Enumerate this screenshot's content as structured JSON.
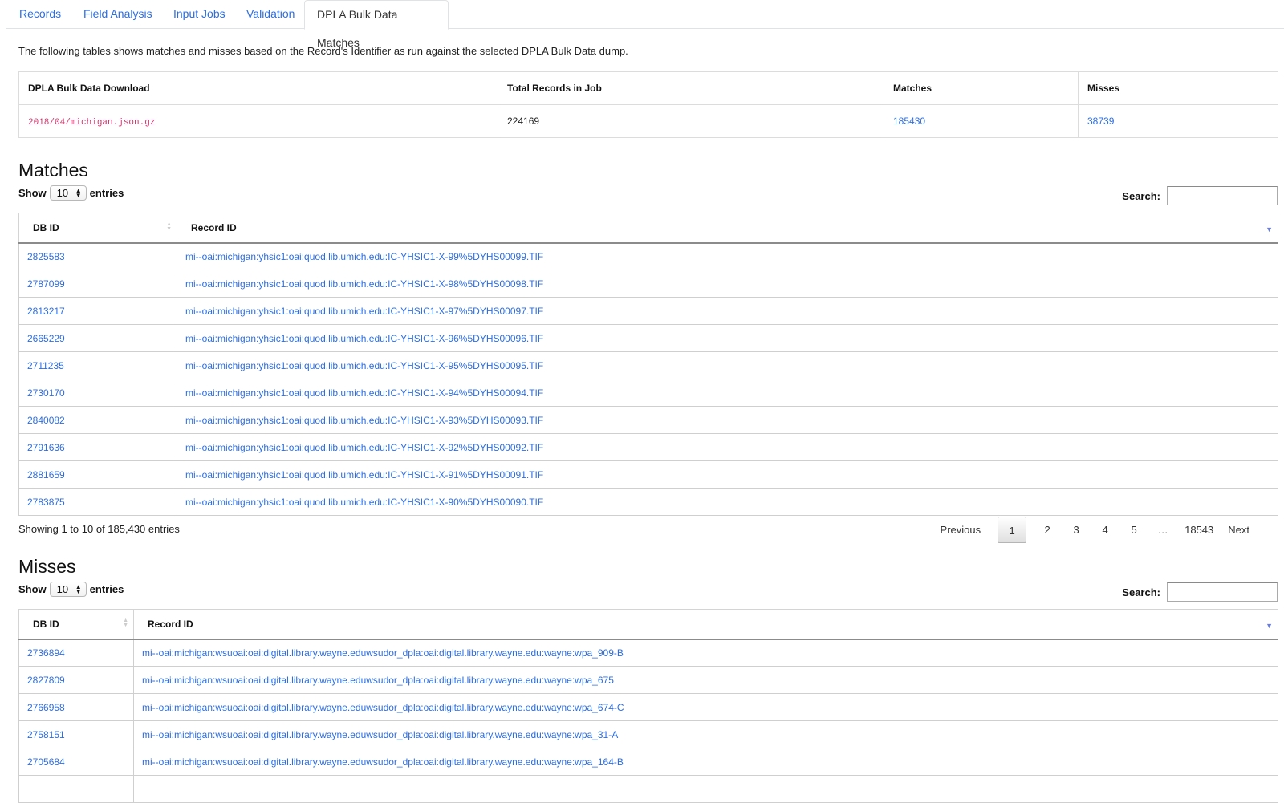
{
  "tabs": [
    {
      "label": "Records",
      "active": false
    },
    {
      "label": "Field Analysis",
      "active": false
    },
    {
      "label": "Input Jobs",
      "active": false
    },
    {
      "label": "Validation",
      "active": false
    },
    {
      "label": "DPLA Bulk Data Matches",
      "active": true
    }
  ],
  "intro": "The following tables shows matches and misses based on the Record's Identifier as run against the selected DPLA Bulk Data dump.",
  "summary": {
    "headers": [
      "DPLA Bulk Data Download",
      "Total Records in Job",
      "Matches",
      "Misses"
    ],
    "row": {
      "download": "2018/04/michigan.json.gz",
      "total": "224169",
      "matches": "185430",
      "misses": "38739"
    }
  },
  "matches": {
    "title": "Matches",
    "show_label": "Show",
    "entries_label": "entries",
    "page_length": "10",
    "search_label": "Search:",
    "search_value": "",
    "columns": [
      "DB ID",
      "Record ID"
    ],
    "rows": [
      {
        "db_id": "2825583",
        "record_id": "mi--oai:michigan:yhsic1:oai:quod.lib.umich.edu:IC-YHSIC1-X-99%5DYHS00099.TIF"
      },
      {
        "db_id": "2787099",
        "record_id": "mi--oai:michigan:yhsic1:oai:quod.lib.umich.edu:IC-YHSIC1-X-98%5DYHS00098.TIF"
      },
      {
        "db_id": "2813217",
        "record_id": "mi--oai:michigan:yhsic1:oai:quod.lib.umich.edu:IC-YHSIC1-X-97%5DYHS00097.TIF"
      },
      {
        "db_id": "2665229",
        "record_id": "mi--oai:michigan:yhsic1:oai:quod.lib.umich.edu:IC-YHSIC1-X-96%5DYHS00096.TIF"
      },
      {
        "db_id": "2711235",
        "record_id": "mi--oai:michigan:yhsic1:oai:quod.lib.umich.edu:IC-YHSIC1-X-95%5DYHS00095.TIF"
      },
      {
        "db_id": "2730170",
        "record_id": "mi--oai:michigan:yhsic1:oai:quod.lib.umich.edu:IC-YHSIC1-X-94%5DYHS00094.TIF"
      },
      {
        "db_id": "2840082",
        "record_id": "mi--oai:michigan:yhsic1:oai:quod.lib.umich.edu:IC-YHSIC1-X-93%5DYHS00093.TIF"
      },
      {
        "db_id": "2791636",
        "record_id": "mi--oai:michigan:yhsic1:oai:quod.lib.umich.edu:IC-YHSIC1-X-92%5DYHS00092.TIF"
      },
      {
        "db_id": "2881659",
        "record_id": "mi--oai:michigan:yhsic1:oai:quod.lib.umich.edu:IC-YHSIC1-X-91%5DYHS00091.TIF"
      },
      {
        "db_id": "2783875",
        "record_id": "mi--oai:michigan:yhsic1:oai:quod.lib.umich.edu:IC-YHSIC1-X-90%5DYHS00090.TIF"
      }
    ],
    "info": "Showing 1 to 10 of 185,430 entries",
    "pagination": {
      "previous": "Previous",
      "pages": [
        "1",
        "2",
        "3",
        "4",
        "5"
      ],
      "ellipsis": "…",
      "last": "18543",
      "next": "Next",
      "current": "1"
    }
  },
  "misses": {
    "title": "Misses",
    "show_label": "Show",
    "entries_label": "entries",
    "page_length": "10",
    "search_label": "Search:",
    "search_value": "",
    "columns": [
      "DB ID",
      "Record ID"
    ],
    "rows": [
      {
        "db_id": "2736894",
        "record_id": "mi--oai:michigan:wsuoai:oai:digital.library.wayne.eduwsudor_dpla:oai:digital.library.wayne.edu:wayne:wpa_909-B"
      },
      {
        "db_id": "2827809",
        "record_id": "mi--oai:michigan:wsuoai:oai:digital.library.wayne.eduwsudor_dpla:oai:digital.library.wayne.edu:wayne:wpa_675"
      },
      {
        "db_id": "2766958",
        "record_id": "mi--oai:michigan:wsuoai:oai:digital.library.wayne.eduwsudor_dpla:oai:digital.library.wayne.edu:wayne:wpa_674-C"
      },
      {
        "db_id": "2758151",
        "record_id": "mi--oai:michigan:wsuoai:oai:digital.library.wayne.eduwsudor_dpla:oai:digital.library.wayne.edu:wayne:wpa_31-A"
      },
      {
        "db_id": "2705684",
        "record_id": "mi--oai:michigan:wsuoai:oai:digital.library.wayne.eduwsudor_dpla:oai:digital.library.wayne.edu:wayne:wpa_164-B"
      },
      {
        "db_id": "",
        "record_id": ""
      }
    ]
  },
  "colors": {
    "link": "#2d6ee0",
    "code": "#d6336c",
    "sort_active": "#6b7ed8"
  }
}
